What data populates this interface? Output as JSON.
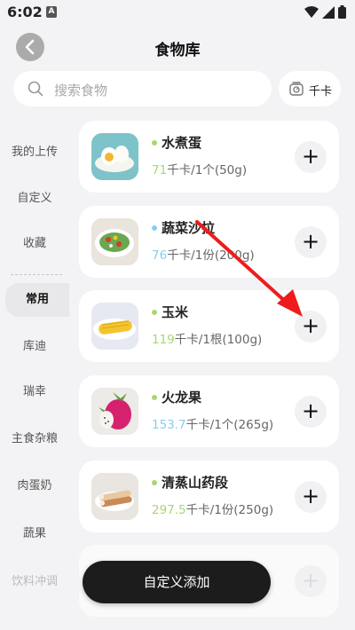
{
  "status": {
    "time": "6:02",
    "app_glyph": "A"
  },
  "header": {
    "title": "食物库"
  },
  "search": {
    "placeholder": "搜索食物",
    "unit_toggle": "千卡"
  },
  "sidebar": {
    "items": [
      {
        "label": "我的上传"
      },
      {
        "label": "自定义"
      },
      {
        "label": "收藏"
      },
      {
        "label": "常用",
        "active": true
      },
      {
        "label": "库迪"
      },
      {
        "label": "瑞幸"
      },
      {
        "label": "主食杂粮"
      },
      {
        "label": "肉蛋奶"
      },
      {
        "label": "蔬果"
      },
      {
        "label": "饮料冲调"
      }
    ]
  },
  "foods": [
    {
      "name": "水煮蛋",
      "kcal": "71",
      "unit_text": "千卡/1个(50g)",
      "dot_color": "#a6d86e",
      "kcal_color": "#a6d86e",
      "icon": "boiled-egg-icon"
    },
    {
      "name": "蔬菜沙拉",
      "kcal": "76",
      "unit_text": "千卡/1份(200g)",
      "dot_color": "#8ccbee",
      "kcal_color": "#8ccbee",
      "icon": "salad-icon"
    },
    {
      "name": "玉米",
      "kcal": "119",
      "unit_text": "千卡/1根(100g)",
      "dot_color": "#a6d86e",
      "kcal_color": "#a6d86e",
      "icon": "corn-icon"
    },
    {
      "name": "火龙果",
      "kcal": "153.7",
      "unit_text": "千卡/1个(265g)",
      "dot_color": "#a6d86e",
      "kcal_color": "#8ccbee",
      "icon": "dragon-fruit-icon"
    },
    {
      "name": "清蒸山药段",
      "kcal": "297.5",
      "unit_text": "千卡/1份(250g)",
      "dot_color": "#a6d86e",
      "kcal_color": "#a6d86e",
      "icon": "yam-icon"
    }
  ],
  "add_symbol": "+",
  "fab": {
    "label": "自定义添加"
  },
  "colors": {
    "background": "#f3f3f5",
    "arrow": "#ee1c1c",
    "fab": "#1c1c1c"
  }
}
